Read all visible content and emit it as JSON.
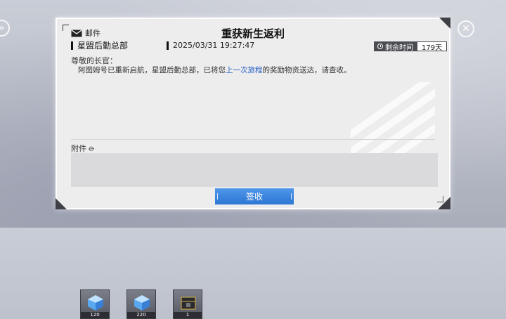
{
  "mail": {
    "category_label": "邮件",
    "title": "重获新生返利",
    "sender": "星盟后勤总部",
    "date": "2025/03/31 19:27:47",
    "remaining_label": "剩余时间",
    "remaining_value": "179天",
    "greeting": "尊敬的长官：",
    "body_before": "阿图姆号已重新启航，星盟后勤总部，已将您",
    "body_link": "上一次旅程",
    "body_after": "的奖励物资送达，请查收。",
    "attachments_label": "附件",
    "attachments": [
      {
        "icon": "blue-crystal-icon",
        "count": "120"
      },
      {
        "icon": "blue-crystal-icon",
        "count": "220"
      },
      {
        "icon": "supply-crate-icon",
        "count": "1"
      }
    ],
    "claim_label": "签收"
  },
  "colors": {
    "accent": "#3a85df",
    "panel_bg": "#ededee",
    "link": "#2a63c4"
  }
}
